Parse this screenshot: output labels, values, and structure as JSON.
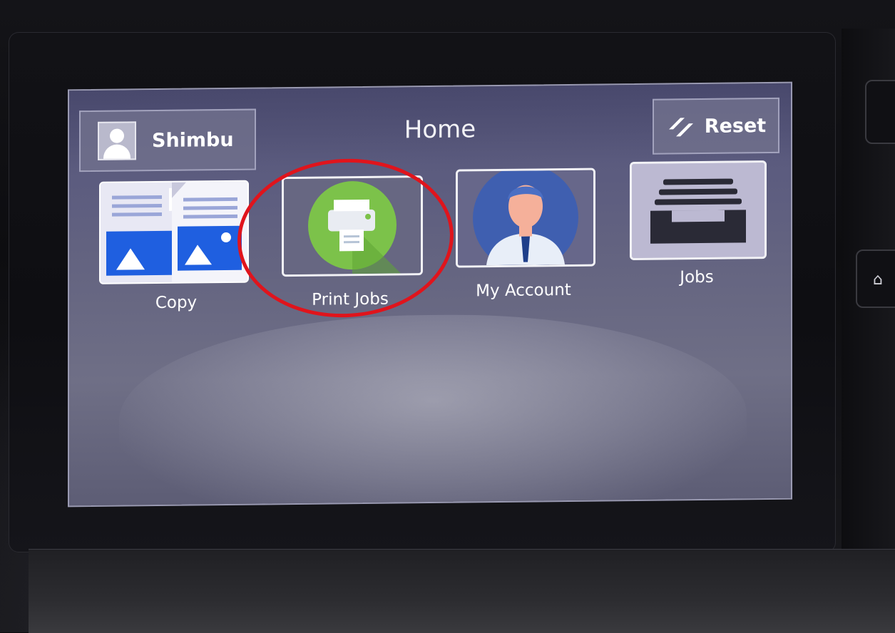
{
  "header": {
    "user_name": "Shimbu",
    "title": "Home",
    "reset_label": "Reset"
  },
  "tiles": [
    {
      "id": "copy",
      "label": "Copy",
      "icon": "copy-icon"
    },
    {
      "id": "print-jobs",
      "label": "Print Jobs",
      "icon": "printer-icon",
      "highlighted": true
    },
    {
      "id": "my-account",
      "label": "My Account",
      "icon": "account-person-icon"
    },
    {
      "id": "jobs",
      "label": "Jobs",
      "icon": "jobs-tray-icon"
    }
  ],
  "icons": {
    "user": "user-avatar-icon",
    "reset": "reset-slashes-icon",
    "hardware_home": "home-icon"
  },
  "colors": {
    "screen_background": "#5f5f80",
    "print_icon_green": "#7cc24a",
    "account_icon_blue": "#3f5fb0",
    "copy_picture_blue": "#1f5fe0",
    "highlight_ring": "#e0141c"
  }
}
